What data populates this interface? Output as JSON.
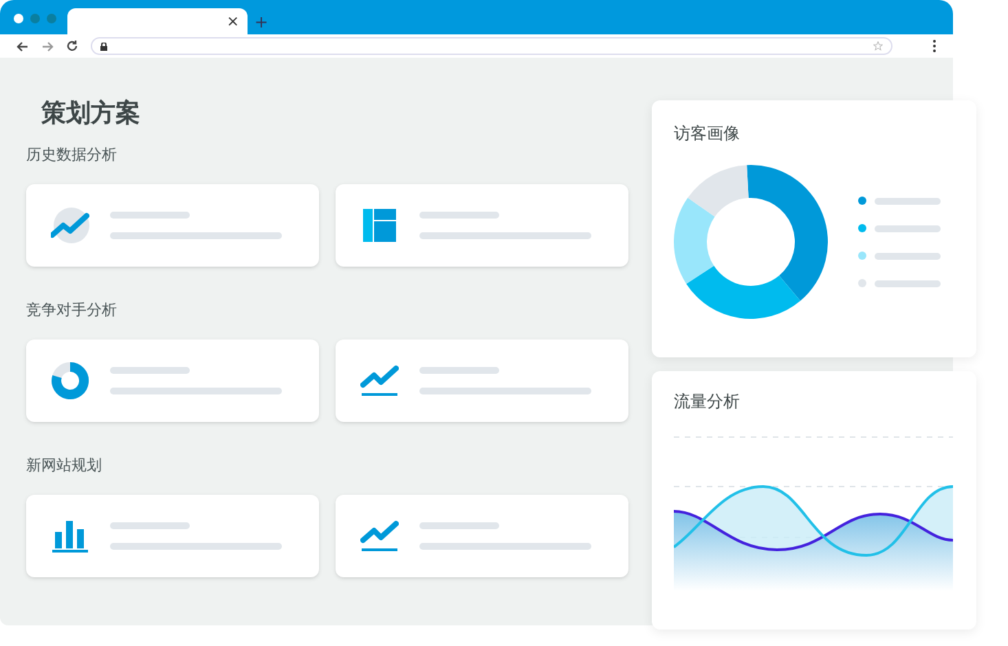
{
  "browser": {
    "tab_close": "×",
    "new_tab": "+"
  },
  "page_title": "策划方案",
  "sections": [
    {
      "heading": "历史数据分析",
      "cards": [
        {
          "kind": "trend"
        },
        {
          "kind": "grid"
        }
      ]
    },
    {
      "heading": "竞争对手分析",
      "cards": [
        {
          "kind": "donut"
        },
        {
          "kind": "line"
        }
      ]
    },
    {
      "heading": "新网站规划",
      "cards": [
        {
          "kind": "bars"
        },
        {
          "kind": "line"
        }
      ]
    }
  ],
  "visitor_panel": {
    "title": "访客画像",
    "legend": [
      {
        "color": "#0099d9"
      },
      {
        "color": "#00bbee"
      },
      {
        "color": "#99e6fb"
      },
      {
        "color": "#e1e6eb"
      }
    ]
  },
  "traffic_panel": {
    "title": "流量分析"
  }
}
